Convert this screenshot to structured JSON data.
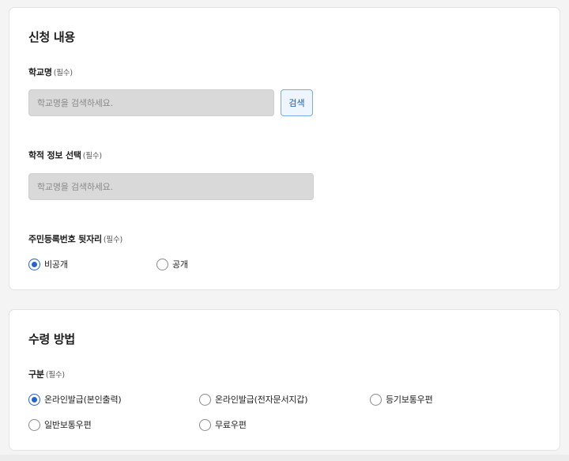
{
  "application": {
    "title": "신청 내용",
    "school": {
      "label": "학교명",
      "required": "(필수)",
      "placeholder": "학교명을 검색하세요.",
      "search_button": "검색"
    },
    "academic": {
      "label": "학적 정보 선택",
      "required": "(필수)",
      "placeholder": "학교명을 검색하세요."
    },
    "rrn": {
      "label": "주민등록번호 뒷자리",
      "required": "(필수)",
      "options": [
        {
          "label": "비공개",
          "checked": true
        },
        {
          "label": "공개",
          "checked": false
        }
      ]
    }
  },
  "receipt": {
    "title": "수령 방법",
    "category": {
      "label": "구분",
      "required": "(필수)",
      "options": [
        {
          "label": "온라인발급(본인출력)",
          "checked": true
        },
        {
          "label": "온라인발급(전자문서지갑)",
          "checked": false
        },
        {
          "label": "등기보통우편",
          "checked": false
        },
        {
          "label": "일반보통우편",
          "checked": false
        },
        {
          "label": "무료우편",
          "checked": false
        }
      ]
    }
  },
  "colors": {
    "accent": "#2563c9",
    "button_text": "#1d59a7",
    "disabled_input": "#d9d9d9"
  }
}
